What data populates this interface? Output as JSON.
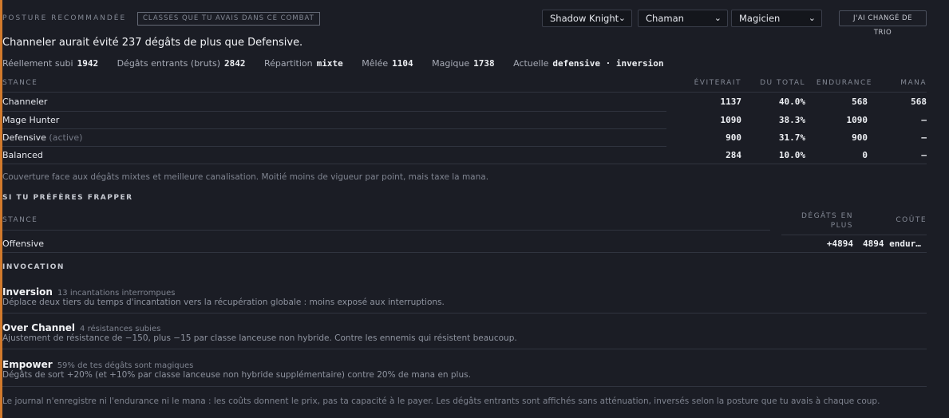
{
  "header": {
    "section_label": "POSTURE RECOMMANDÉE",
    "tag": "CLASSES QUE TU AVAIS DANS CE COMBAT",
    "selects": [
      "Shadow Knight",
      "Chaman",
      "Magicien"
    ],
    "trio_button": "J'AI CHANGÉ DE TRIO"
  },
  "headline": "Channeler aurait évité 237 dégâts de plus que Defensive.",
  "stats": [
    {
      "label": "Réellement subi",
      "value": "1942"
    },
    {
      "label": "Dégâts entrants (bruts)",
      "value": "2842"
    },
    {
      "label": "Répartition",
      "value": "mixte"
    },
    {
      "label": "Mêlée",
      "value": "1104"
    },
    {
      "label": "Magique",
      "value": "1738"
    },
    {
      "label": "Actuelle",
      "value": "defensive · inversion"
    }
  ],
  "stance_table": {
    "headers": {
      "stance": "STANCE",
      "eviterait": "ÉVITERAIT",
      "du_total": "DU TOTAL",
      "endurance": "ENDURANCE",
      "mana": "MANA"
    },
    "rows": [
      {
        "name": "Channeler",
        "note": "",
        "eviterait": "1137",
        "du_total": "40.0%",
        "endurance": "568",
        "mana": "568"
      },
      {
        "name": "Mage Hunter",
        "note": "",
        "eviterait": "1090",
        "du_total": "38.3%",
        "endurance": "1090",
        "mana": "—"
      },
      {
        "name": "Defensive",
        "note": "(active)",
        "eviterait": "900",
        "du_total": "31.7%",
        "endurance": "900",
        "mana": "—"
      },
      {
        "name": "Balanced",
        "note": "",
        "eviterait": "284",
        "du_total": "10.0%",
        "endurance": "0",
        "mana": "—"
      }
    ]
  },
  "coverage_note": "Couverture face aux dégâts mixtes et meilleure canalisation. Moitié moins de vigueur par point, mais taxe la mana.",
  "strike": {
    "title": "SI TU PRÉFÈRES FRAPPER",
    "headers": {
      "stance": "STANCE",
      "degats_line1": "DÉGÂTS EN",
      "degats_line2": "PLUS",
      "cout": "COÛTE"
    },
    "rows": [
      {
        "name": "Offensive",
        "degats": "+4894",
        "cout": "4894 endur…"
      }
    ]
  },
  "invocation": {
    "title": "INVOCATION",
    "items": [
      {
        "name": "Inversion",
        "sub": "13 incantations interrompues",
        "desc": "Déplace deux tiers du temps d'incantation vers la récupération globale : moins exposé aux interruptions."
      },
      {
        "name": "Over Channel",
        "sub": "4 résistances subies",
        "desc": "Ajustement de résistance de −150, plus −15 par classe lanceuse non hybride. Contre les ennemis qui résistent beaucoup."
      },
      {
        "name": "Empower",
        "sub": "59% de tes dégâts sont magiques",
        "desc": "Dégâts de sort +20% (et +10% par classe lanceuse non hybride supplémentaire) contre 20% de mana en plus."
      }
    ]
  },
  "footer": "Le journal n'enregistre ni l'endurance ni le mana : les coûts donnent le prix, pas ta capacité à le payer. Les dégâts entrants sont affichés sans atténuation, inversés selon la posture que tu avais à chaque coup.",
  "colors": {
    "accent": "#d27a2c",
    "background": "#1b1d25"
  }
}
